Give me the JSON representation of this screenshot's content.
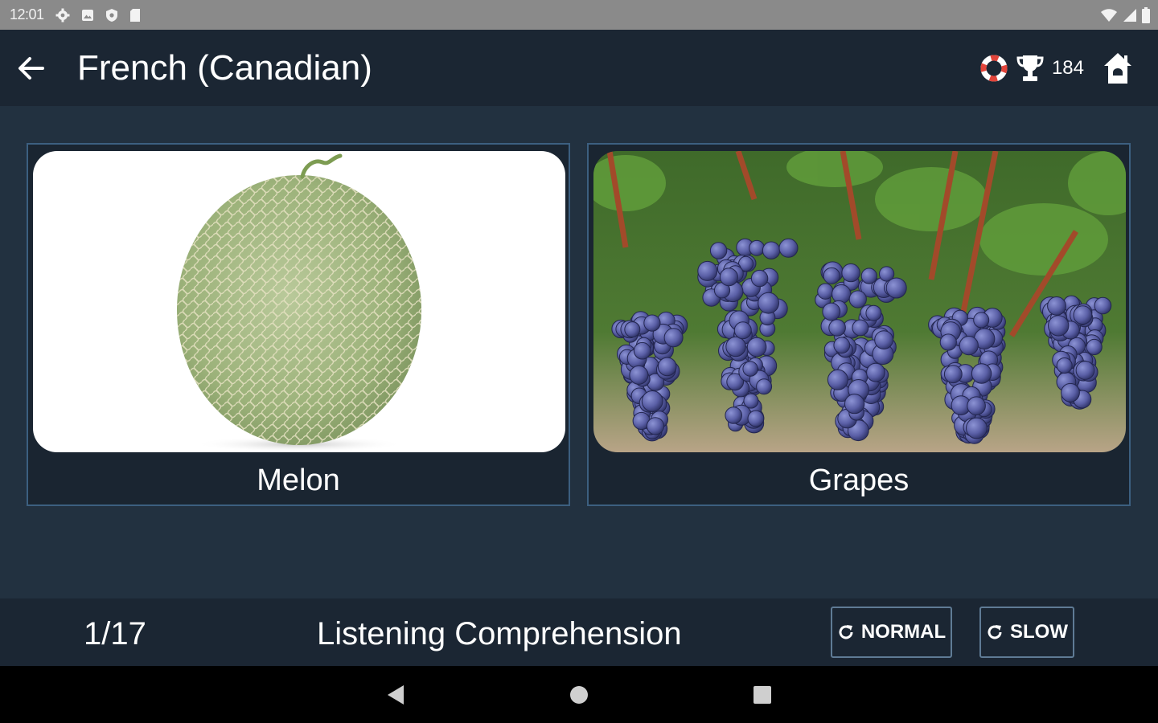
{
  "status_bar": {
    "time": "12:01",
    "left_icons": [
      "settings-icon",
      "photo-icon",
      "shield-icon",
      "sd-card-icon"
    ],
    "right_icons": [
      "wifi-icon",
      "signal-icon",
      "battery-icon"
    ]
  },
  "app_bar": {
    "title": "French (Canadian)",
    "score": "184",
    "icons": [
      "back-arrow-icon",
      "lifebuoy-icon",
      "trophy-icon",
      "home-icon"
    ]
  },
  "choices": [
    {
      "label": "Melon",
      "image": "melon-photo"
    },
    {
      "label": "Grapes",
      "image": "grapes-photo"
    }
  ],
  "footer": {
    "progress": "1/17",
    "mode": "Listening Comprehension",
    "normal_label": "NORMAL",
    "slow_label": "SLOW"
  },
  "nav": {
    "icons": [
      "nav-back-icon",
      "nav-home-icon",
      "nav-recents-icon"
    ]
  },
  "colors": {
    "background": "#223140",
    "bar": "#1b2633",
    "card_border": "#3c5f80",
    "button_border": "#5f7b95"
  }
}
